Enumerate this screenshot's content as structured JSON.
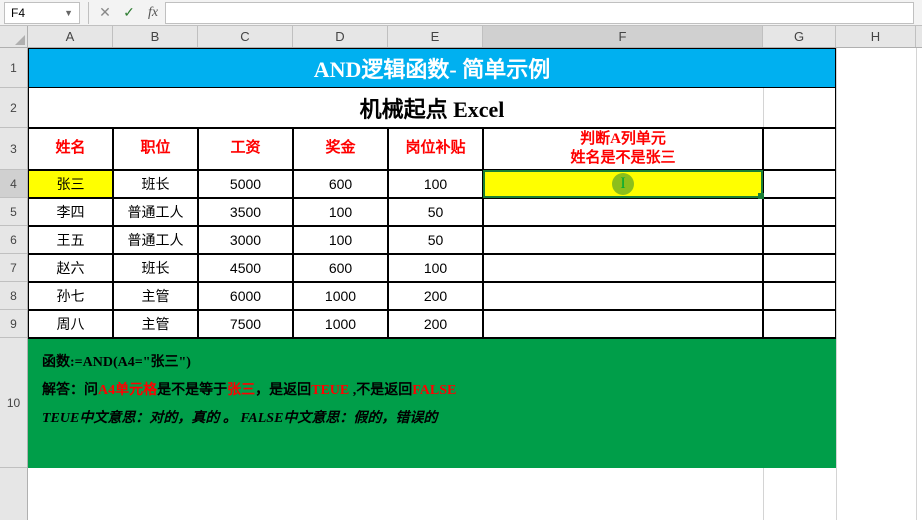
{
  "formula_bar": {
    "cell_ref": "F4",
    "cancel": "✕",
    "confirm": "✓",
    "fx": "fx"
  },
  "columns": [
    "A",
    "B",
    "C",
    "D",
    "E",
    "F",
    "G",
    "H"
  ],
  "rows": [
    "1",
    "2",
    "3",
    "4",
    "5",
    "6",
    "7",
    "8",
    "9",
    "10"
  ],
  "title": "AND逻辑函数- 简单示例",
  "subtitle": "机械起点 Excel",
  "headers": {
    "name": "姓名",
    "position": "职位",
    "salary": "工资",
    "bonus": "奖金",
    "allowance": "岗位补贴",
    "judge": "判断A列单元\n姓名是不是张三"
  },
  "data": [
    {
      "name": "张三",
      "position": "班长",
      "salary": "5000",
      "bonus": "600",
      "allowance": "100"
    },
    {
      "name": "李四",
      "position": "普通工人",
      "salary": "3500",
      "bonus": "100",
      "allowance": "50"
    },
    {
      "name": "王五",
      "position": "普通工人",
      "salary": "3000",
      "bonus": "100",
      "allowance": "50"
    },
    {
      "name": "赵六",
      "position": "班长",
      "salary": "4500",
      "bonus": "600",
      "allowance": "100"
    },
    {
      "name": "孙七",
      "position": "主管",
      "salary": "6000",
      "bonus": "1000",
      "allowance": "200"
    },
    {
      "name": "周八",
      "position": "主管",
      "salary": "7500",
      "bonus": "1000",
      "allowance": "200"
    }
  ],
  "explain": {
    "l1a": "函数:=AND(A4=\"张三\")",
    "l2a": "解答：问",
    "l2b": "A4单元格",
    "l2c": "是不是等于",
    "l2d": "张三",
    "l2e": "，是返回",
    "l2f": "TEUE",
    "l2g": " ,不是返回",
    "l2h": "FALSE",
    "l3": "TEUE中文意思：对的，真的 。 FALSE中文意思：假的，错误的"
  }
}
